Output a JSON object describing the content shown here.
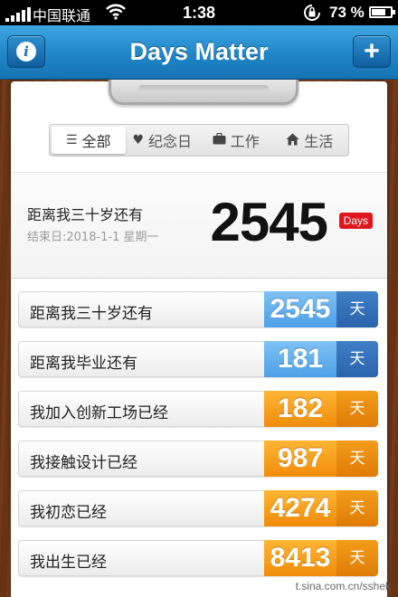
{
  "status_bar": {
    "carrier": "中国联通",
    "time": "1:38",
    "battery": "73 %"
  },
  "nav": {
    "title": "Days Matter"
  },
  "filters": [
    {
      "label": "全部",
      "icon": "list-icon",
      "active": true
    },
    {
      "label": "纪念日",
      "icon": "heart-icon",
      "active": false
    },
    {
      "label": "工作",
      "icon": "briefcase-icon",
      "active": false
    },
    {
      "label": "生活",
      "icon": "home-icon",
      "active": false
    }
  ],
  "summary": {
    "title": "距离我三十岁还有",
    "end_date": "结束日:2018-1-1 星期一",
    "count": "2545",
    "badge": "Days"
  },
  "events": [
    {
      "label": "距离我三十岁还有",
      "count": "2545",
      "unit": "天",
      "color": "blue"
    },
    {
      "label": "距离我毕业还有",
      "count": "181",
      "unit": "天",
      "color": "blue"
    },
    {
      "label": "我加入创新工场已经",
      "count": "182",
      "unit": "天",
      "color": "orange"
    },
    {
      "label": "我接触设计已经",
      "count": "987",
      "unit": "天",
      "color": "orange"
    },
    {
      "label": "我初恋已经",
      "count": "4274",
      "unit": "天",
      "color": "orange"
    },
    {
      "label": "我出生已经",
      "count": "8413",
      "unit": "天",
      "color": "orange"
    }
  ],
  "watermark": "t.sina.com.cn/sshek",
  "colors": {
    "nav_blue": "#1f86c8",
    "future_blue": "#4d9fe6",
    "past_orange": "#f08d0a",
    "badge_red": "#e0161d"
  }
}
